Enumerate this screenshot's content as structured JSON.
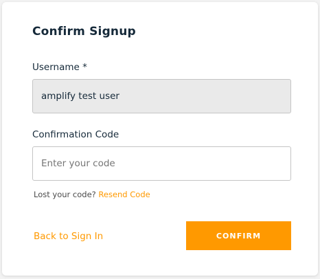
{
  "form": {
    "title": "Confirm Signup",
    "username": {
      "label": "Username *",
      "value": "amplify test user"
    },
    "code": {
      "label": "Confirmation Code",
      "placeholder": "Enter your code",
      "value": ""
    },
    "hint": {
      "text": "Lost your code?",
      "link": "Resend Code"
    },
    "back_link": "Back to Sign In",
    "confirm_button": "CONFIRM"
  },
  "colors": {
    "accent": "#ff9900",
    "text": "#152939",
    "disabled_input_bg": "#eaeaea"
  }
}
